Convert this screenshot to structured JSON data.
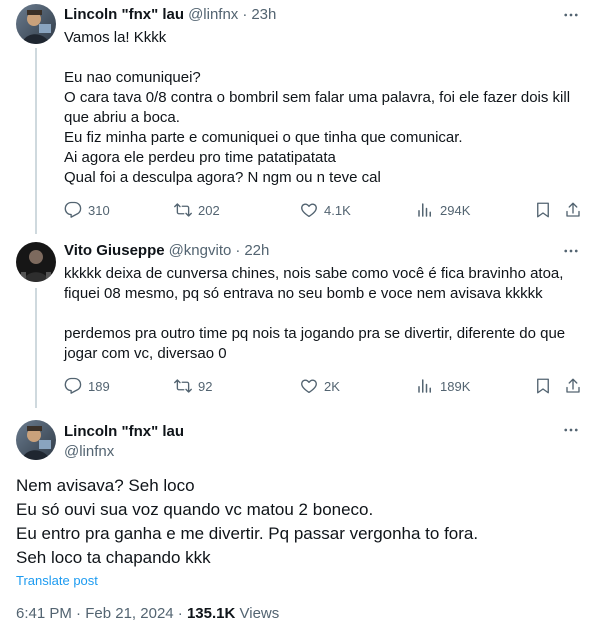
{
  "thread": {
    "reply1": {
      "display_name": "Lincoln \"fnx\" lau",
      "handle": "@linfnx",
      "separator": "·",
      "time": "23h",
      "paragraphs": [
        "Vamos la! Kkkk",
        "",
        "Eu nao comuniquei?",
        "O cara tava 0/8 contra o bombril sem falar uma palavra, foi ele fazer dois kill que abriu a boca.",
        "Eu fiz minha parte e comuniquei o que tinha que comunicar.",
        "Ai agora ele perdeu pro time patatipatata",
        "Qual foi a desculpa agora? N ngm ou n teve cal"
      ],
      "stats": {
        "replies": "310",
        "reposts": "202",
        "likes": "4.1K",
        "views": "294K"
      }
    },
    "reply2": {
      "display_name": "Vito Giuseppe",
      "handle": "@kngvito",
      "separator": "·",
      "time": "22h",
      "paragraphs": [
        "kkkkk deixa de cunversa chines, nois sabe como você é fica bravinho atoa, fiquei 08 mesmo, pq só entrava no seu bomb e voce nem avisava kkkkk",
        "",
        "perdemos pra outro time pq nois ta jogando pra se divertir, diferente do que jogar com vc, diversao 0"
      ],
      "stats": {
        "replies": "189",
        "reposts": "92",
        "likes": "2K",
        "views": "189K"
      }
    },
    "main": {
      "display_name": "Lincoln \"fnx\" lau",
      "handle": "@linfnx",
      "paragraphs": [
        "Nem avisava? Seh loco",
        "Eu só ouvi sua voz quando vc matou 2 boneco.",
        "Eu entro pra ganha e me divertir. Pq passar vergonha to fora.",
        "Seh loco ta chapando kkk"
      ],
      "translate_label": "Translate post",
      "meta_time": "6:41 PM",
      "meta_separator": "·",
      "meta_date": "Feb 21, 2024",
      "meta_views": "135.1K",
      "meta_views_label": "Views"
    }
  },
  "icons": {
    "more": "more-icon",
    "reply": "reply-icon",
    "repost": "repost-icon",
    "like": "heart-icon",
    "views": "views-icon",
    "bookmark": "bookmark-icon",
    "share": "share-icon"
  },
  "colors": {
    "text": "#0f1419",
    "secondary": "#536471",
    "link": "#1d9bf0",
    "thread_line": "#cfd9de"
  }
}
